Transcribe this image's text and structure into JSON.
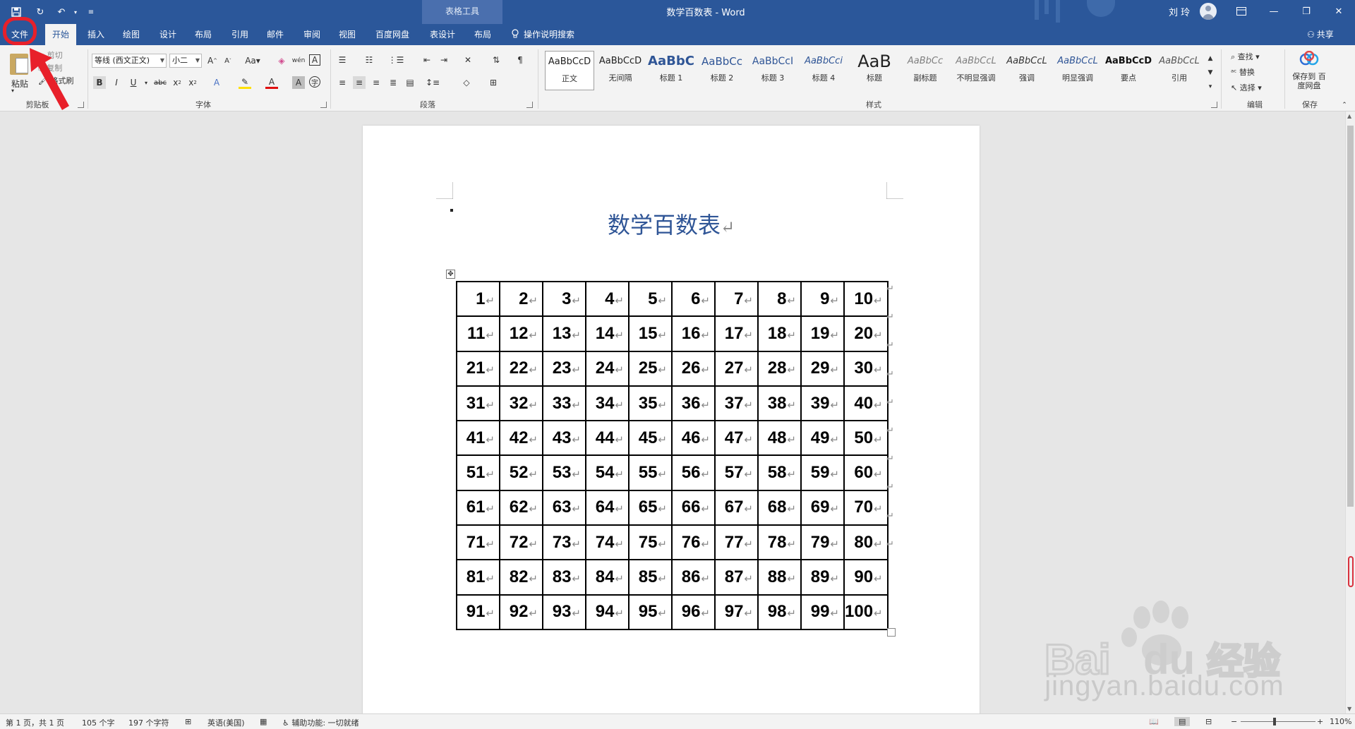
{
  "titlebar": {
    "context_group": "表格工具",
    "doc_title": "数学百数表 - Word",
    "user_name": "刘 玲"
  },
  "tabs": [
    "文件",
    "开始",
    "插入",
    "绘图",
    "设计",
    "布局",
    "引用",
    "邮件",
    "审阅",
    "视图",
    "百度网盘",
    "表设计",
    "布局"
  ],
  "active_tab": "开始",
  "tell_me": "操作说明搜索",
  "share": "共享",
  "clipboard": {
    "paste": "粘贴",
    "cut": "剪切",
    "copy": "复制",
    "format_painter": "格式刷",
    "group_label": "剪贴板"
  },
  "font": {
    "family": "等线 (西文正文)",
    "size": "小二",
    "group_label": "字体"
  },
  "paragraph": {
    "group_label": "段落"
  },
  "styles": {
    "group_label": "样式",
    "items": [
      {
        "sample": "AaBbCcD",
        "name": "正文",
        "color": "#222222"
      },
      {
        "sample": "AaBbCcD",
        "name": "无间隔",
        "color": "#222222"
      },
      {
        "sample": "AaBbC",
        "name": "标题 1",
        "color": "#2f5596"
      },
      {
        "sample": "AaBbCc",
        "name": "标题 2",
        "color": "#2f5596"
      },
      {
        "sample": "AaBbCcI",
        "name": "标题 3",
        "color": "#2f5596"
      },
      {
        "sample": "AaBbCci",
        "name": "标题 4",
        "color": "#2f5596"
      },
      {
        "sample": "AaB",
        "name": "标题",
        "color": "#222222"
      },
      {
        "sample": "AaBbCc",
        "name": "副标题",
        "color": "#7f7f7f"
      },
      {
        "sample": "AaBbCcL",
        "name": "不明显强调",
        "color": "#7f7f7f"
      },
      {
        "sample": "AaBbCcL",
        "name": "强调",
        "color": "#333333"
      },
      {
        "sample": "AaBbCcL",
        "name": "明显强调",
        "color": "#2f5596"
      },
      {
        "sample": "AaBbCcD",
        "name": "要点",
        "color": "#111111"
      },
      {
        "sample": "AaBbCcL",
        "name": "引用",
        "color": "#555555"
      }
    ]
  },
  "editing": {
    "find": "查找",
    "replace": "替换",
    "select": "选择",
    "group_label": "编辑"
  },
  "save_group": {
    "button": "保存到 百度网盘",
    "group_label": "保存"
  },
  "document": {
    "heading": "数学百数表",
    "table": [
      [
        "1",
        "2",
        "3",
        "4",
        "5",
        "6",
        "7",
        "8",
        "9",
        "10"
      ],
      [
        "11",
        "12",
        "13",
        "14",
        "15",
        "16",
        "17",
        "18",
        "19",
        "20"
      ],
      [
        "21",
        "22",
        "23",
        "24",
        "25",
        "26",
        "27",
        "28",
        "29",
        "30"
      ],
      [
        "31",
        "32",
        "33",
        "34",
        "35",
        "36",
        "37",
        "38",
        "39",
        "40"
      ],
      [
        "41",
        "42",
        "43",
        "44",
        "45",
        "46",
        "47",
        "48",
        "49",
        "50"
      ],
      [
        "51",
        "52",
        "53",
        "54",
        "55",
        "56",
        "57",
        "58",
        "59",
        "60"
      ],
      [
        "61",
        "62",
        "63",
        "64",
        "65",
        "66",
        "67",
        "68",
        "69",
        "70"
      ],
      [
        "71",
        "72",
        "73",
        "74",
        "75",
        "76",
        "77",
        "78",
        "79",
        "80"
      ],
      [
        "81",
        "82",
        "83",
        "84",
        "85",
        "86",
        "87",
        "88",
        "89",
        "90"
      ],
      [
        "91",
        "92",
        "93",
        "94",
        "95",
        "96",
        "97",
        "98",
        "99",
        "100"
      ]
    ]
  },
  "statusbar": {
    "page": "第 1 页，共 1 页",
    "words": "105 个字",
    "chars": "197 个字符",
    "language": "英语(美国)",
    "accessibility": "辅助功能: 一切就绪",
    "zoom": "110%"
  },
  "watermark": {
    "text": "jingyan.baidu.com"
  },
  "colors": {
    "ribbon_blue": "#2b579a",
    "heading_blue": "#2f5596",
    "highlight_red": "#e8202a"
  }
}
